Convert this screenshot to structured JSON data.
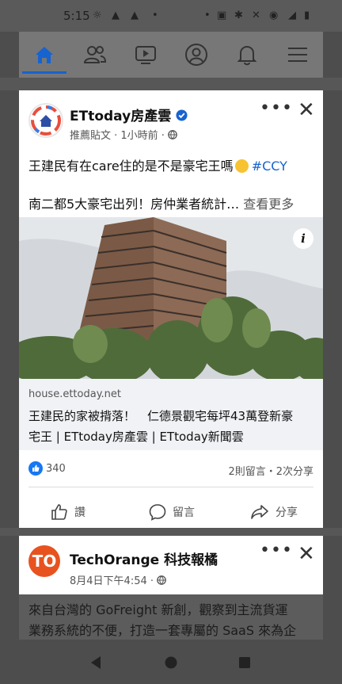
{
  "status_bar": {
    "time": "5:15"
  },
  "nav": {
    "tabs": [
      {
        "name": "home",
        "icon": "home-icon",
        "active": true
      },
      {
        "name": "friends",
        "icon": "friends-icon"
      },
      {
        "name": "watch",
        "icon": "video-icon"
      },
      {
        "name": "profile",
        "icon": "profile-icon"
      },
      {
        "name": "notifications",
        "icon": "bell-icon"
      },
      {
        "name": "menu",
        "icon": "menu-icon"
      }
    ]
  },
  "post1": {
    "page_name": "ETtoday房產雲",
    "meta": "推薦貼文 · 1小時前 · ",
    "line1": "王建民有在care住的是不是豪宅王嗎",
    "hashtag": "#CCY",
    "line2": "南二都5大豪宅出列！房仲業者統計…",
    "see_more": "查看更多",
    "link_domain": "house.ettoday.net",
    "link_title_1": "王建民的家被揹落！　仁德景觀宅每坪43萬登新豪",
    "link_title_2": "宅王 | ETtoday房產雲 | ETtoday新聞雲",
    "reactions": "340",
    "stats": "2則留言・2次分享",
    "like_label": "讚",
    "comment_label": "留言",
    "share_label": "分享"
  },
  "post2": {
    "page_name": "TechOrange 科技報橘",
    "avatar_text": "TO",
    "meta": "8月4日下午4:54 · "
  },
  "bottom_text": {
    "line1": "來自台灣的 GoFreight 新創，觀察到主流貨運",
    "line2": "業務系統的不便，打造一套專屬的 SaaS 來為企"
  },
  "colors": {
    "accent": "#1763cf",
    "techorange": "#e8521f"
  }
}
